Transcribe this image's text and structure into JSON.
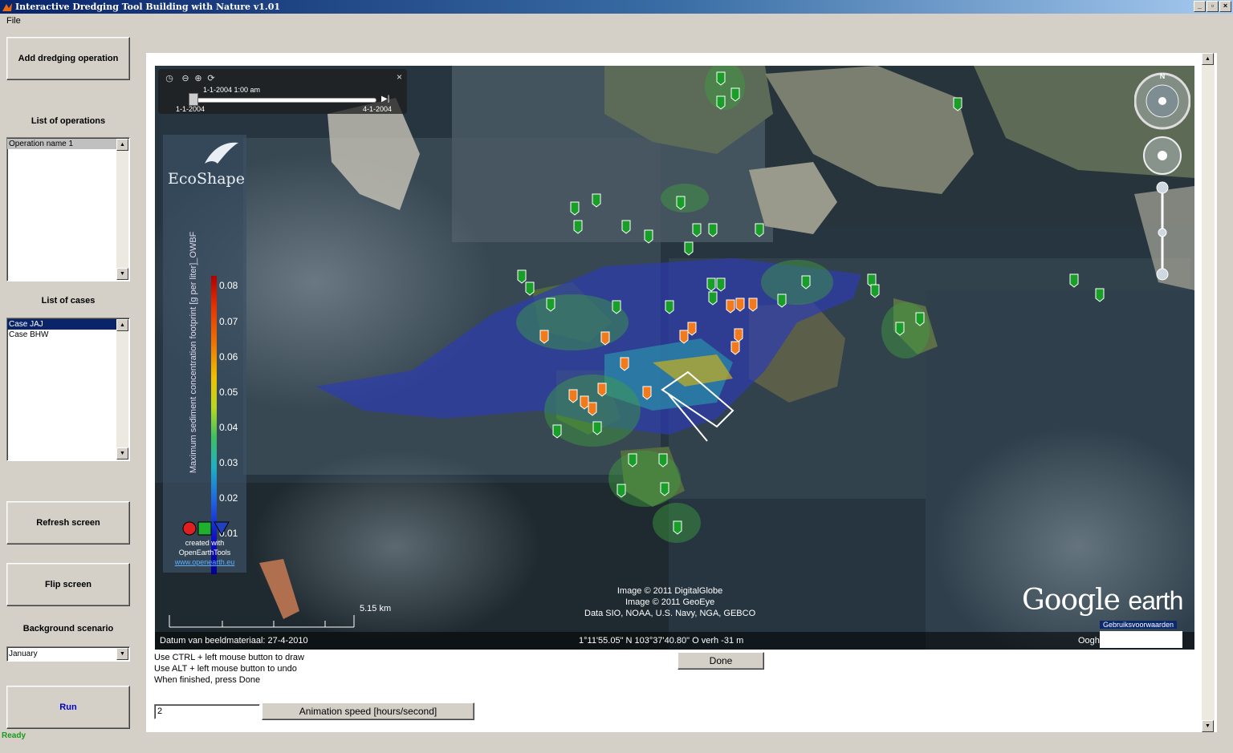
{
  "window": {
    "title": "Interactive Dredging Tool Building with Nature v1.01",
    "controls": [
      "_",
      "▫",
      "×"
    ]
  },
  "menu": {
    "file": "File"
  },
  "left_panel": {
    "add_button": "Add dredging operation",
    "operations_label": "List of operations",
    "operations": [
      "Operation name 1"
    ],
    "cases_label": "List of cases",
    "cases": [
      "Case JAJ",
      "Case BHW"
    ],
    "refresh_button": "Refresh screen",
    "flip_button": "Flip screen",
    "background_label": "Background scenario",
    "background_value": "January",
    "run_button": "Run",
    "status": "Ready"
  },
  "map": {
    "time_slider": {
      "current": "1-1-2004   1:00 am",
      "start": "1-1-2004",
      "end": "4-1-2004"
    },
    "legend": {
      "brand": "EcoShape",
      "title": "Maximum sediment concentration footprint [g per liter]_OWBF",
      "ticks": [
        "0.08",
        "0.07",
        "0.06",
        "0.05",
        "0.04",
        "0.03",
        "0.02",
        "0.01"
      ],
      "created_with": "created with",
      "tool": "OpenEarthTools",
      "url": "www.openearth.eu"
    },
    "credits": [
      "Image © 2011 DigitalGlobe",
      "Image © 2011 GeoEye",
      "Data SIO, NOAA, U.S. Navy, NGA, GEBCO"
    ],
    "scale": "5.15 km",
    "logo_google": "Google",
    "logo_earth": "earth",
    "terms": "Gebruiksvoorwaarden",
    "imagery_date": "Datum van beeldmateriaal: 27-4-2010",
    "coordinates": "1°11'55.05\" N  103°37'40.80\" O verh   -31 m",
    "eye_label": "Oogh",
    "compass_n": "N"
  },
  "instructions": [
    "Use CTRL + left mouse button to draw",
    "Use ALT + left mouse button to undo",
    "When finished, press Done"
  ],
  "done_button": "Done",
  "speed": {
    "value": "2",
    "button": "Animation speed [hours/second]"
  },
  "colors": {
    "status_green": "#1a9a1a",
    "run_blue": "#0000cc",
    "selection": "#0a246a"
  }
}
